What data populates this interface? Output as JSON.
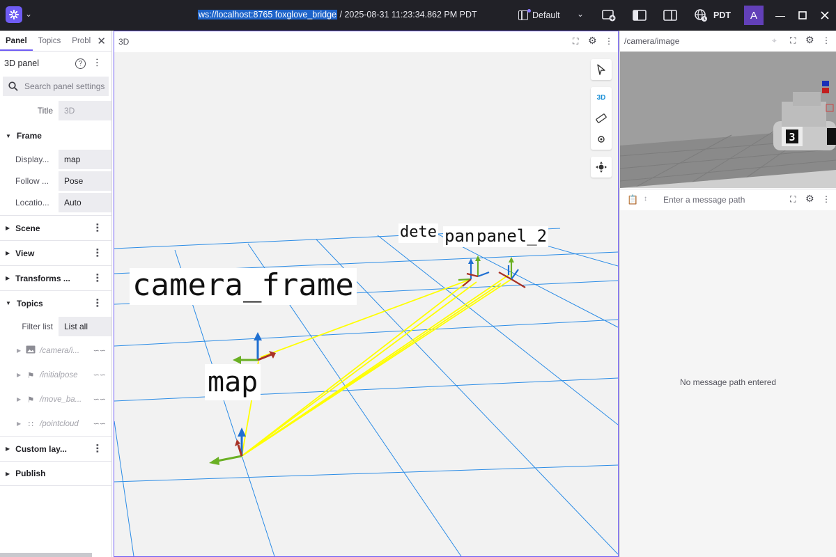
{
  "topbar": {
    "connection_url": "ws://localhost:8765 foxglove_bridge",
    "timestamp": " / 2025-08-31 11:23:34.862 PM PDT",
    "layout_name": "Default",
    "timezone": "PDT",
    "user_initial": "A"
  },
  "sidebar": {
    "tabs": [
      "Panel",
      "Topics",
      "Probl"
    ],
    "panel_title": "3D panel",
    "search_placeholder": "Search panel settings",
    "title_label": "Title",
    "title_placeholder": "3D",
    "frame_section": "Frame",
    "frame_rows": [
      {
        "label": "Display...",
        "value": "map"
      },
      {
        "label": "Follow ...",
        "value": "Pose"
      },
      {
        "label": "Locatio...",
        "value": "Auto"
      }
    ],
    "sections": [
      "Scene",
      "View",
      "Transforms ...",
      "Topics"
    ],
    "filter_label": "Filter list",
    "filter_value": "List all",
    "topics": [
      {
        "name": "/camera/i...",
        "icon": "image-icon"
      },
      {
        "name": "/initialpose",
        "icon": "flag-icon"
      },
      {
        "name": "/move_ba...",
        "icon": "flag-icon"
      },
      {
        "name": "/pointcloud",
        "icon": "pointcloud-icon"
      }
    ],
    "custom_layers": "Custom lay...",
    "publish": "Publish"
  },
  "panel3d": {
    "title": "3D",
    "mode_label": "3D",
    "labels": {
      "camera_frame": "camera_frame",
      "map": "map",
      "dete": "dete",
      "pan": "pan",
      "panel_2": "panel_2"
    },
    "colors": {
      "grid": "#2b8ce6",
      "tf_line": "#ffff00",
      "x_axis": "#c0392b",
      "y_axis": "#6ab023",
      "z_axis": "#1f6fd1"
    }
  },
  "camera_panel": {
    "topic": "/camera/image",
    "marker_number": "3"
  },
  "plot_panel": {
    "path_placeholder": "Enter a message path",
    "empty_message": "No message path entered"
  }
}
